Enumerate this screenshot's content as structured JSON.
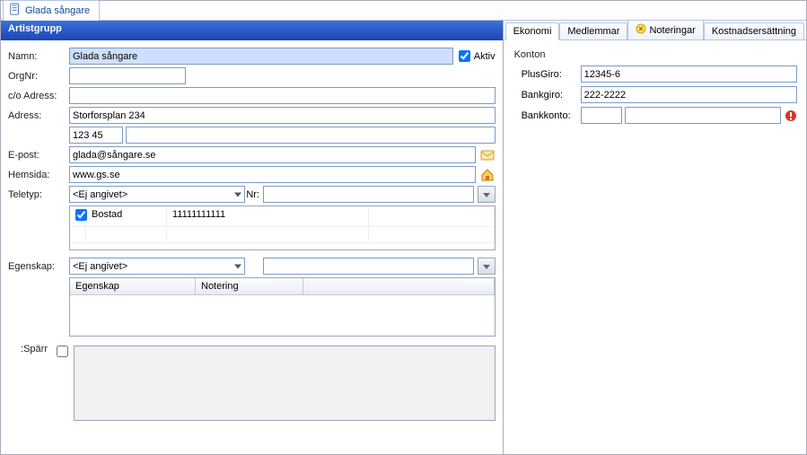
{
  "window_tab": {
    "label": "Glada sångare"
  },
  "header": {
    "title": "Artistgrupp"
  },
  "form": {
    "namn_label": "Namn:",
    "namn_value": "Glada sångare",
    "aktiv_label": "Aktiv",
    "aktiv_checked": true,
    "orgnr_label": "OrgNr:",
    "orgnr_value": "",
    "co_label": "c/o Adress:",
    "co_value": "",
    "adress_label": "Adress:",
    "adress_value": "Storforsplan 234",
    "postnr_value": "123 45",
    "epost_label": "E-post:",
    "epost_value": "glada@sångare.se",
    "hemsida_label": "Hemsida:",
    "hemsida_value": "www.gs.se",
    "teletyp_label": "Teletyp:",
    "teletyp_value": "<Ej angivet>",
    "nr_label": "Nr:",
    "nr_value": "",
    "phone_grid": {
      "rows": [
        {
          "checked": true,
          "type": "Bostad",
          "number": "11111111111"
        }
      ]
    },
    "egenskap_label": "Egenskap:",
    "egenskap_sel": "<Ej angivet>",
    "egenskap_txt": "",
    "eg_grid": {
      "headers": [
        "Egenskap",
        "Notering"
      ],
      "rows": []
    },
    "sparr_label": ":Spärr"
  },
  "right": {
    "tabs": {
      "ekonomi": "Ekonomi",
      "medlemmar": "Medlemmar",
      "noteringar": "Noteringar",
      "kostnad": "Kostnadsersättning"
    },
    "konton": {
      "legend": "Konton",
      "plusgiro_label": "PlusGiro:",
      "plusgiro_value": "12345-6",
      "bankgiro_label": "Bankgiro:",
      "bankgiro_value": "222-2222",
      "bankkonto_label": "Bankkonto:",
      "bankkonto_clearing": "",
      "bankkonto_account": ""
    }
  }
}
